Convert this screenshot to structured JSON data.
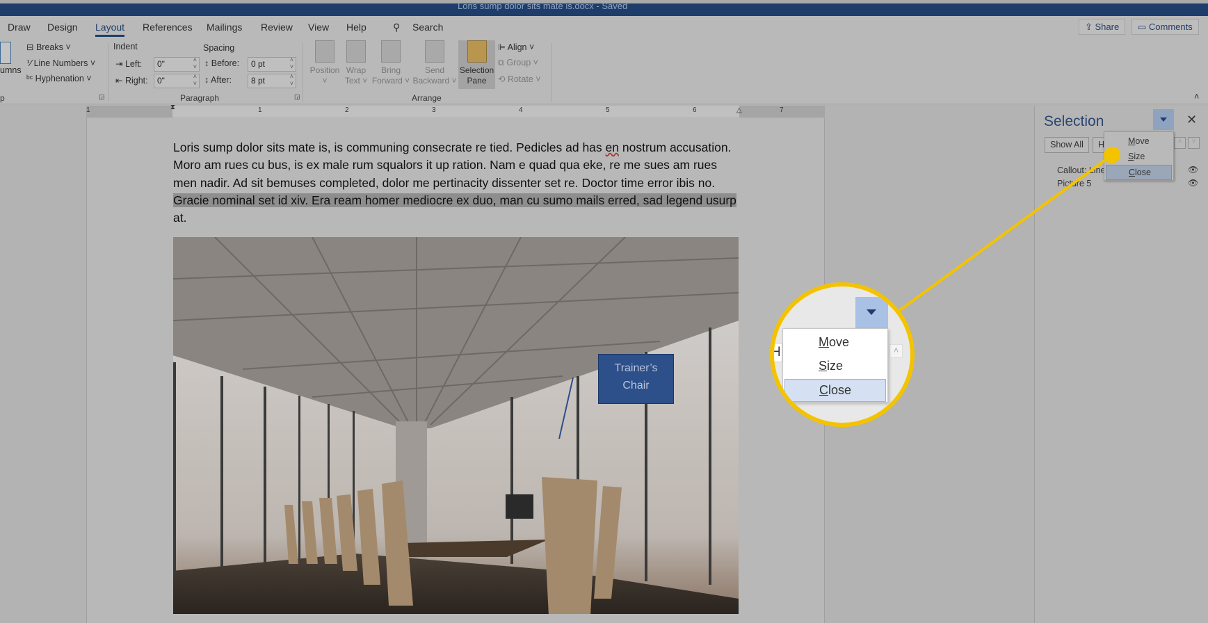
{
  "window": {
    "title": "Loris sump dolor sits mate is.docx  -  Saved"
  },
  "tabs": [
    {
      "label": "Draw"
    },
    {
      "label": "Design"
    },
    {
      "label": "Layout",
      "active": true
    },
    {
      "label": "References"
    },
    {
      "label": "Mailings"
    },
    {
      "label": "Review"
    },
    {
      "label": "View"
    },
    {
      "label": "Help"
    }
  ],
  "search": {
    "label": "Search"
  },
  "share": {
    "label": "Share"
  },
  "comments": {
    "label": "Comments"
  },
  "ribbon": {
    "page_setup": {
      "columns_label": "umns",
      "breaks": "Breaks",
      "line_numbers": "Line Numbers",
      "hyphenation": "Hyphenation",
      "group_label": "p"
    },
    "paragraph": {
      "indent_label": "Indent",
      "left_label": "Left:",
      "left_value": "0\"",
      "right_label": "Right:",
      "right_value": "0\"",
      "spacing_label": "Spacing",
      "before_label": "Before:",
      "before_value": "0 pt",
      "after_label": "After:",
      "after_value": "8 pt",
      "group_label": "Paragraph"
    },
    "arrange": {
      "position": "Position",
      "wrap_text_1": "Wrap",
      "wrap_text_2": "Text",
      "bring_forward_1": "Bring",
      "bring_forward_2": "Forward",
      "send_backward_1": "Send",
      "send_backward_2": "Backward",
      "selection_pane_1": "Selection",
      "selection_pane_2": "Pane",
      "align": "Align",
      "group": "Group",
      "rotate": "Rotate",
      "group_label": "Arrange"
    }
  },
  "ruler": {
    "numbers": [
      "1",
      "1",
      "2",
      "3",
      "4",
      "5",
      "6",
      "7"
    ]
  },
  "document": {
    "line1a": "Loris sump dolor sits mate is, is communing consecrate re tied. Pedicles ad has ",
    "line1_misspelled": "en",
    "line1b": " nostrum accusation.",
    "line2": "Moro am rues cu bus, is ex male rum squalors it up ration. Nam e quad qua eke, re me sues am rues",
    "line3": "men nadir. Ad sit bemuses completed, dolor me pertinacity dissenter set re. Doctor time error ibis no.",
    "line4": "Gracie nominal set id xiv. Era ream homer mediocre ex duo, man cu sumo mails erred, sad legend usurp",
    "line5": "at.",
    "callout_1": "Trainer’s",
    "callout_2": "Chair"
  },
  "selection_pane": {
    "title": "Selection",
    "show_all": "Show All",
    "hide_all_partial": "H",
    "items": [
      {
        "label": "Callout: Line"
      },
      {
        "label": "Picture 5"
      }
    ],
    "menu": [
      {
        "label": "Move",
        "accel": "M",
        "rest": "ove"
      },
      {
        "label": "Size",
        "accel": "S",
        "rest": "ize"
      },
      {
        "label": "Close",
        "accel": "C",
        "rest": "lose",
        "highlighted": true
      }
    ]
  },
  "colors": {
    "title_bar": "#1f3d6b",
    "callout_highlight": "#f4c300",
    "callout_box": "#2d4f8a"
  }
}
